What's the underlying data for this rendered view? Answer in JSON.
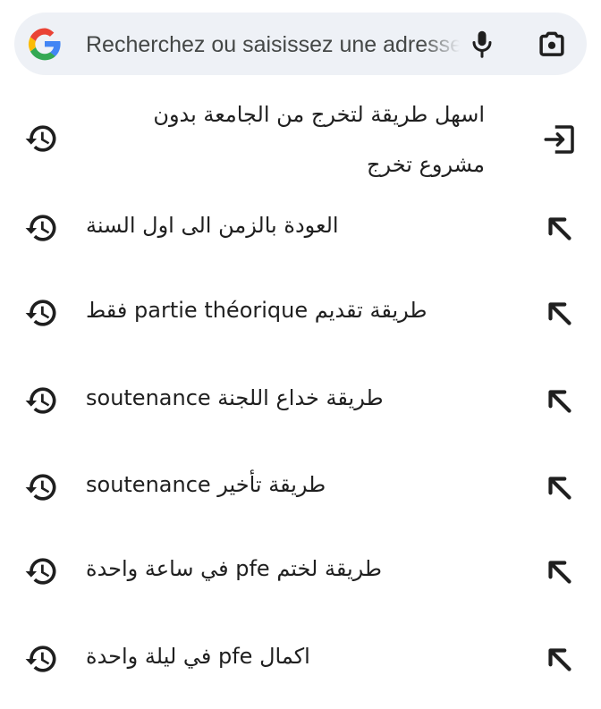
{
  "search": {
    "text": "Recherchez ou saisissez une adresse",
    "logo_icon": "google-g-icon",
    "mic_icon": "microphone-icon",
    "lens_icon": "lens-camera-icon"
  },
  "suggestions": [
    {
      "text": "اسهل طريقة لتخرج من الجامعة بدون مشروع تخرج",
      "icon": "history-icon",
      "action_icon": "open-in-tab-icon"
    },
    {
      "text": "العودة بالزمن الى اول السنة",
      "icon": "history-icon",
      "action_icon": "fill-query-arrow-icon"
    },
    {
      "text": "طريقة تقديم partie théorique فقط",
      "icon": "history-icon",
      "action_icon": "fill-query-arrow-icon"
    },
    {
      "text": "طريقة خداع اللجنة soutenance",
      "icon": "history-icon",
      "action_icon": "fill-query-arrow-icon"
    },
    {
      "text": "طريقة تأخير soutenance",
      "icon": "history-icon",
      "action_icon": "fill-query-arrow-icon"
    },
    {
      "text": "طريقة لختم pfe في ساعة واحدة",
      "icon": "history-icon",
      "action_icon": "fill-query-arrow-icon"
    },
    {
      "text": "اكمال pfe في ليلة واحدة",
      "icon": "history-icon",
      "action_icon": "fill-query-arrow-icon"
    }
  ],
  "colors": {
    "search_bg": "#eef1f6",
    "text": "#1f1f1f",
    "icon": "#1f1f1f",
    "placeholder": "#444746"
  }
}
